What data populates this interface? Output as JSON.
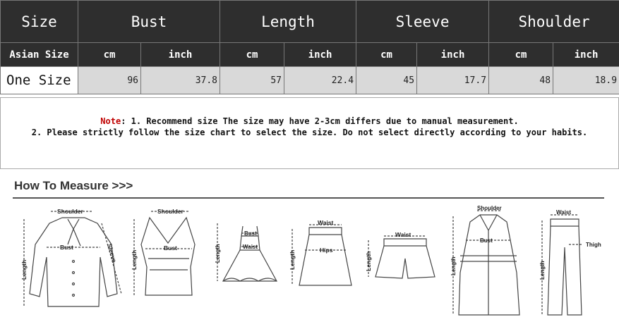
{
  "table": {
    "header": [
      "Size",
      "Bust",
      "Length",
      "Sleeve",
      "Shoulder"
    ],
    "units_label": "Asian Size",
    "unit_cm": "cm",
    "unit_inch": "inch",
    "rows": [
      {
        "size": "One Size",
        "values": [
          "96",
          "37.8",
          "57",
          "22.4",
          "45",
          "17.7",
          "48",
          "18.9"
        ]
      }
    ]
  },
  "note": {
    "label": "Note",
    "line1": ": 1. Recommend size  The size may have 2-3cm differs due to manual measurement.",
    "line2": "2. Please strictly follow the size chart to select the size. Do not select directly according to your habits."
  },
  "how_to": {
    "title": "How To Measure >>>",
    "labels": {
      "shoulder": "Shoulder",
      "bust": "Bust",
      "length": "Length",
      "sleeve": "Sleeve",
      "waist": "Waist",
      "hips": "Hips",
      "thigh": "Thigh"
    }
  }
}
